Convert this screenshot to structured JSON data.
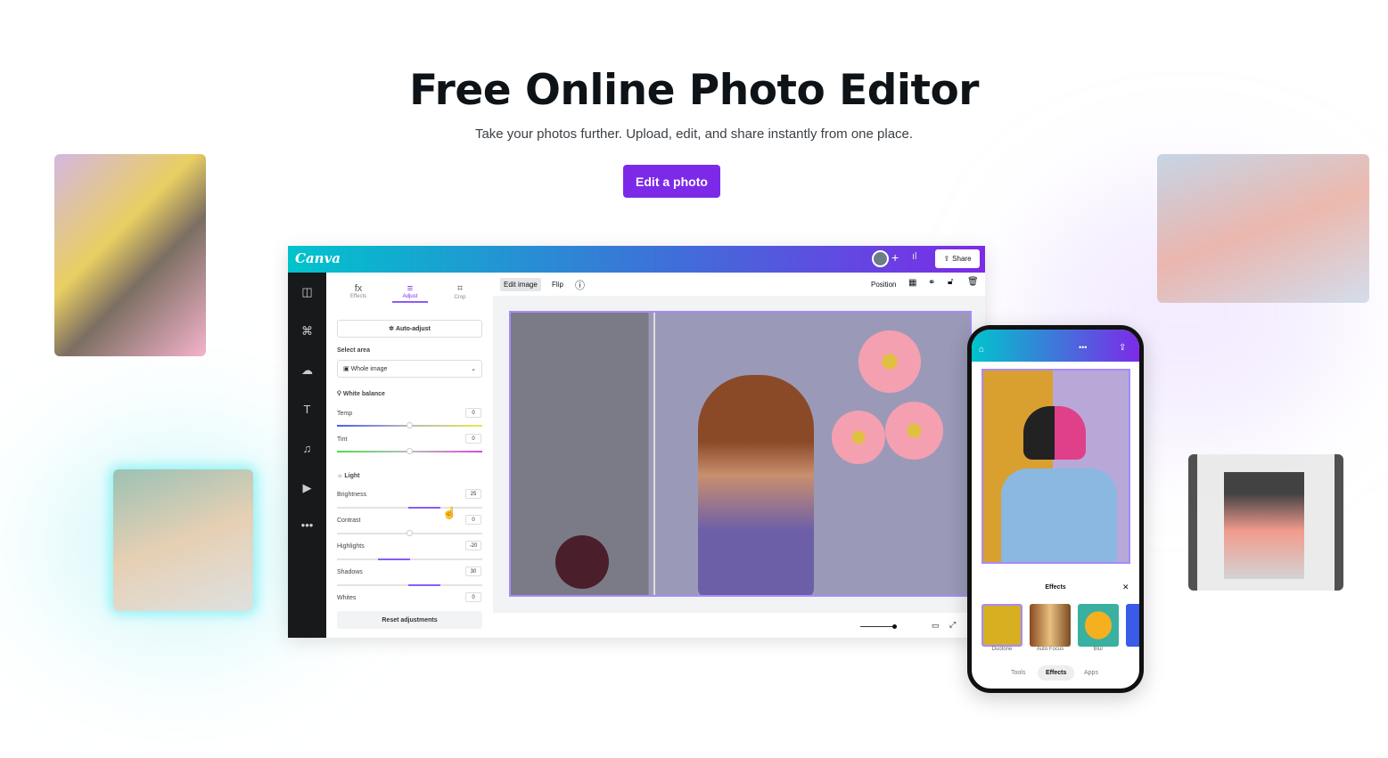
{
  "hero": {
    "title": "Free Online Photo Editor",
    "subtitle": "Take your photos further. Upload, edit, and share instantly from one place.",
    "cta": "Edit a photo"
  },
  "colors": {
    "brand": "#7d2ae8",
    "teal": "#00c4cc"
  },
  "editor": {
    "logo": "Canva",
    "share": "Share",
    "rail_icons": [
      "layout-icon",
      "elements-icon",
      "upload-icon",
      "text-icon",
      "music-icon",
      "video-icon",
      "more-icon"
    ],
    "tabs": [
      {
        "icon": "fx",
        "label": "Effects"
      },
      {
        "icon": "≡",
        "label": "Adjust"
      },
      {
        "icon": "⌗",
        "label": "Crop"
      }
    ],
    "auto_adjust": "Auto-adjust",
    "select_area_label": "Select area",
    "select_area_value": "Whole image",
    "white_balance": "White balance",
    "light": "Light",
    "sliders": [
      {
        "label": "Temp",
        "value": "0"
      },
      {
        "label": "Tint",
        "value": "0"
      },
      {
        "label": "Brightness",
        "value": "25"
      },
      {
        "label": "Contrast",
        "value": "0"
      },
      {
        "label": "Highlights",
        "value": "-20"
      },
      {
        "label": "Shadows",
        "value": "30"
      },
      {
        "label": "Whites",
        "value": "0"
      }
    ],
    "reset": "Reset adjustments",
    "toolbar": {
      "edit_image": "Edit image",
      "flip": "Flip",
      "position": "Position"
    }
  },
  "phone": {
    "effects_title": "Effects",
    "effects": [
      "Duotone",
      "Auto Focus",
      "Blur"
    ],
    "nav": [
      "Tools",
      "Effects",
      "Apps"
    ]
  }
}
